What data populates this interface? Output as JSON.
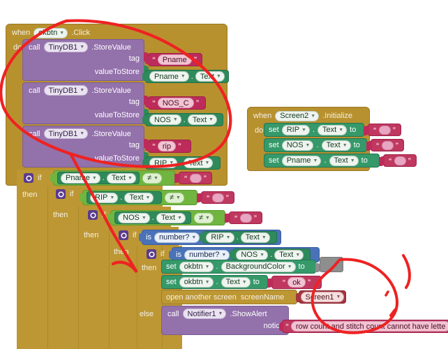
{
  "app": {
    "name": "MIT App Inventor Blocks Editor",
    "canvas_background": "#ffffff"
  },
  "palette": {
    "event_gold": "#b8912f",
    "control_gold": "#bd9733",
    "method_purple": "#9371ab",
    "component_green": "#2f8a5b",
    "logic_green": "#6fb53f",
    "text_crimson": "#bc2b5a",
    "math_blue": "#4a72b8",
    "screen_darkred": "#a5343f",
    "color_swatch_grey": "#8e8e8e",
    "annotation_red": "#ee2222"
  },
  "blocks": {
    "okbtn_click": {
      "when_label": "when",
      "component": "okbtn",
      "event": ".Click",
      "do_label": "do"
    },
    "store_value_1": {
      "call_label": "call",
      "component": "TinyDB1",
      "method": ".StoreValue",
      "tag_label": "tag",
      "tag_value": "Pname",
      "value_label": "valueToStore",
      "value_component": "Pname",
      "value_property": "Text"
    },
    "store_value_2": {
      "call_label": "call",
      "component": "TinyDB1",
      "method": ".StoreValue",
      "tag_label": "tag",
      "tag_value": "NOS_C",
      "value_label": "valueToStore",
      "value_component": "NOS",
      "value_property": "Text"
    },
    "store_value_3": {
      "call_label": "call",
      "component": "TinyDB1",
      "method": ".StoreValue",
      "tag_label": "tag",
      "tag_value": "rip",
      "value_label": "valueToStore",
      "value_component": "RIP",
      "value_property": "Text"
    },
    "screen2_initialize": {
      "when_label": "when",
      "component": "Screen2",
      "event": ".Initialize",
      "do_label": "do",
      "setters": [
        {
          "set_label": "set",
          "component": "RIP",
          "dot": ".",
          "property": "Text",
          "to_label": "to",
          "value": ""
        },
        {
          "set_label": "set",
          "component": "NOS",
          "dot": ".",
          "property": "Text",
          "to_label": "to",
          "value": ""
        },
        {
          "set_label": "set",
          "component": "Pname",
          "dot": ".",
          "property": "Text",
          "to_label": "to",
          "value": ""
        }
      ]
    },
    "if_1": {
      "if_label": "if",
      "then_label": "then",
      "left_component": "Pname",
      "dot": ".",
      "left_property": "Text",
      "operator": "≠",
      "right_value": ""
    },
    "if_2": {
      "if_label": "if",
      "then_label": "then",
      "left_component": "RIP",
      "dot": ".",
      "left_property": "Text",
      "operator": "≠",
      "right_value": ""
    },
    "if_3": {
      "if_label": "if",
      "then_label": "then",
      "left_component": "NOS",
      "dot": ".",
      "left_property": "Text",
      "operator": "≠",
      "right_value": ""
    },
    "if_4": {
      "if_label": "if",
      "then_label": "then",
      "is_label": "is",
      "test": "number?",
      "arg_component": "RIP",
      "dot": ".",
      "arg_property": "Text"
    },
    "if_5": {
      "if_label": "if",
      "then_label": "then",
      "else_label": "else",
      "is_label": "is",
      "test": "number?",
      "arg_component": "NOS",
      "dot": ".",
      "arg_property": "Text"
    },
    "set_bgcolor": {
      "set_label": "set",
      "component": "okbtn",
      "dot": ".",
      "property": "BackgroundColor",
      "to_label": "to",
      "color_value": "#8e8e8e"
    },
    "set_text_ok": {
      "set_label": "set",
      "component": "okbtn",
      "dot": ".",
      "property": "Text",
      "to_label": "to",
      "value": "ok"
    },
    "open_screen": {
      "label": "open another screen",
      "arg_label": "screenName",
      "screen": "Screen1"
    },
    "show_alert": {
      "call_label": "call",
      "component": "Notifier1",
      "method": ".ShowAlert",
      "notice_label": "notice",
      "notice_value": "row count and stitch count cannot have lette"
    }
  },
  "annotations": {
    "type": "hand-drawn-red-ink",
    "shapes": [
      "large-ellipse-around-tinydb-storevalue-stack",
      "diagonal-stroke-through-nested-ifs",
      "ellipse-around-notifier-showalert-notice",
      "short-arc-right-of-notice",
      "small-tick-mark"
    ]
  }
}
